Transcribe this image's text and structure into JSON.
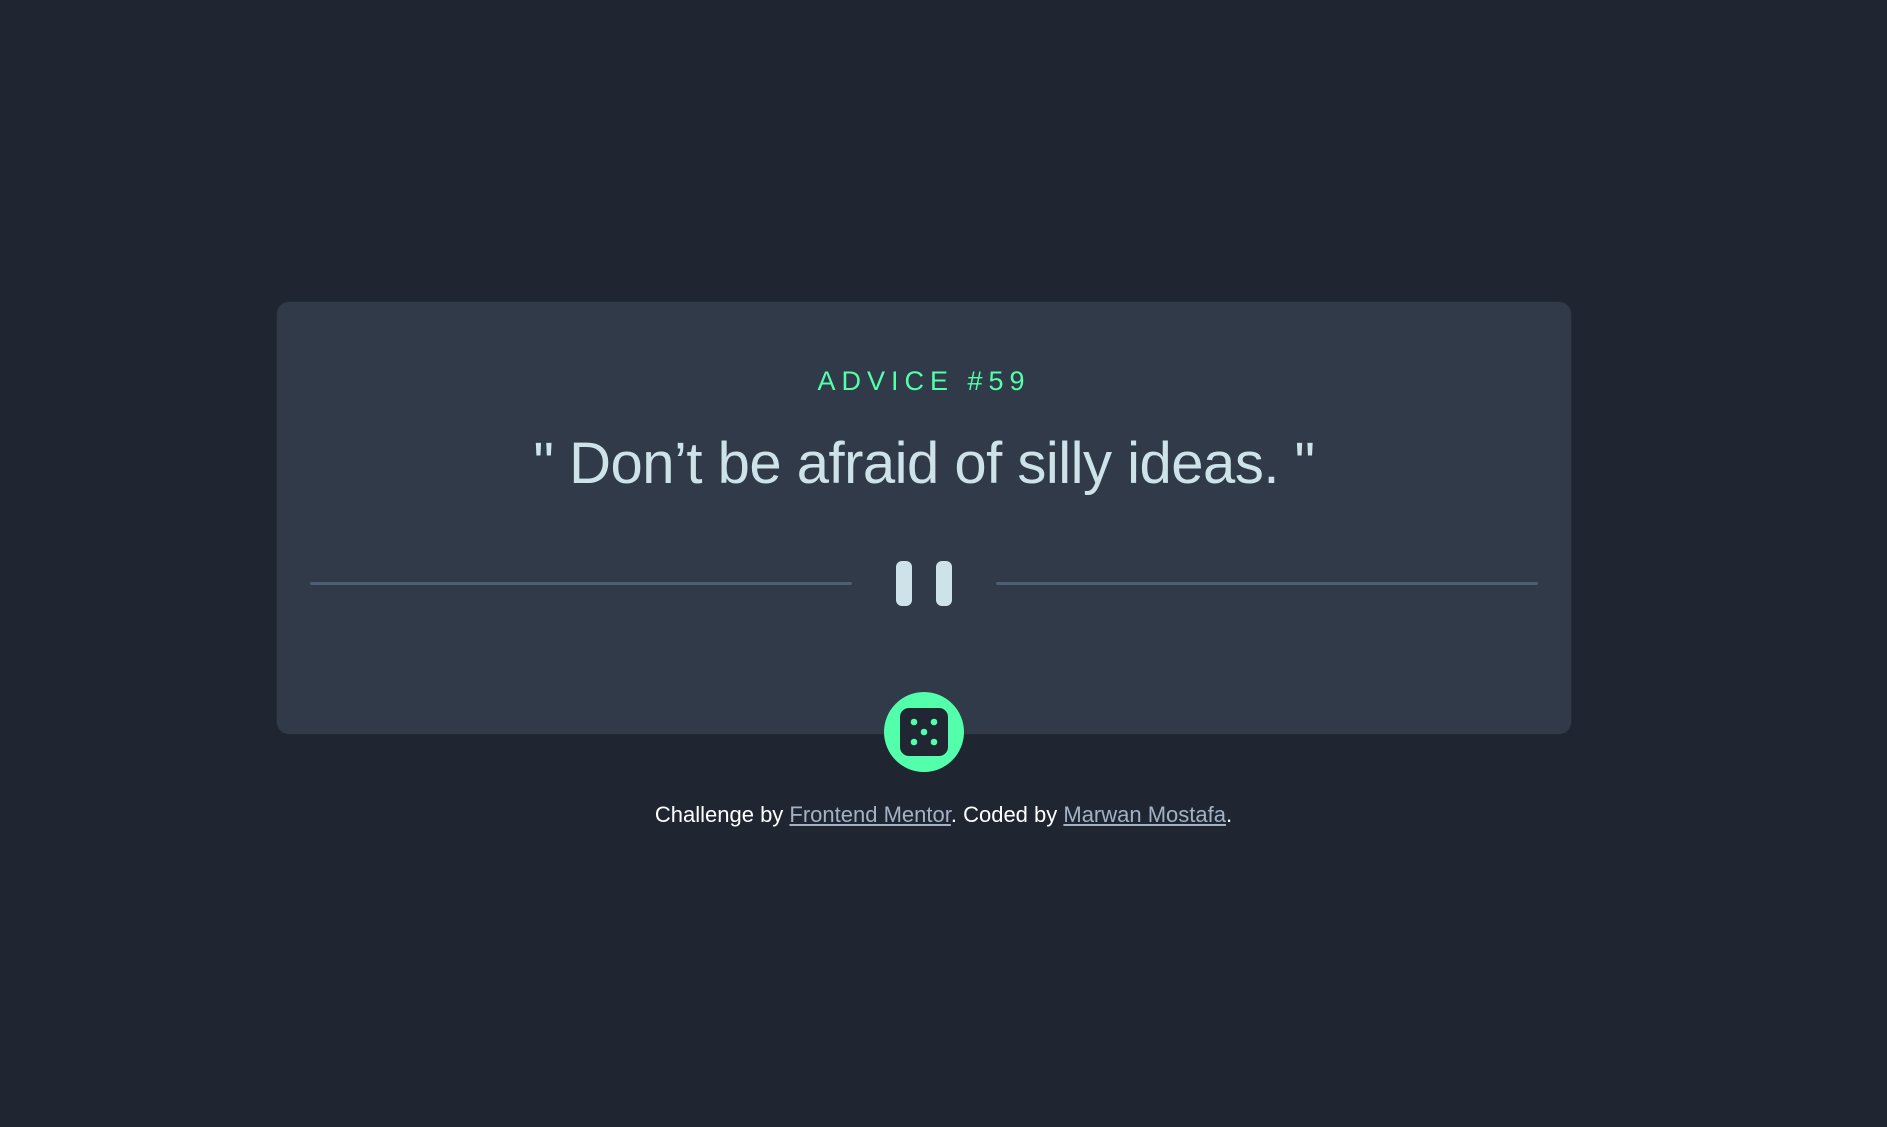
{
  "card": {
    "advice_label": "ADVICE #59",
    "quote": "\" Don’t be afraid of silly ideas. \""
  },
  "divider": {
    "icon": "pause-icon"
  },
  "dice_button": {
    "icon": "dice-icon"
  },
  "attribution": {
    "prefix": "Challenge by ",
    "link1": "Frontend Mentor",
    "middle": ". Coded by ",
    "link2": "Marwan Mostafa",
    "suffix": "."
  },
  "colors": {
    "background": "#1f2632",
    "card": "#313a48",
    "accent": "#53ffaa",
    "text": "#cee3e9",
    "divider": "#4e5d73",
    "link": "#a4b0c4"
  }
}
